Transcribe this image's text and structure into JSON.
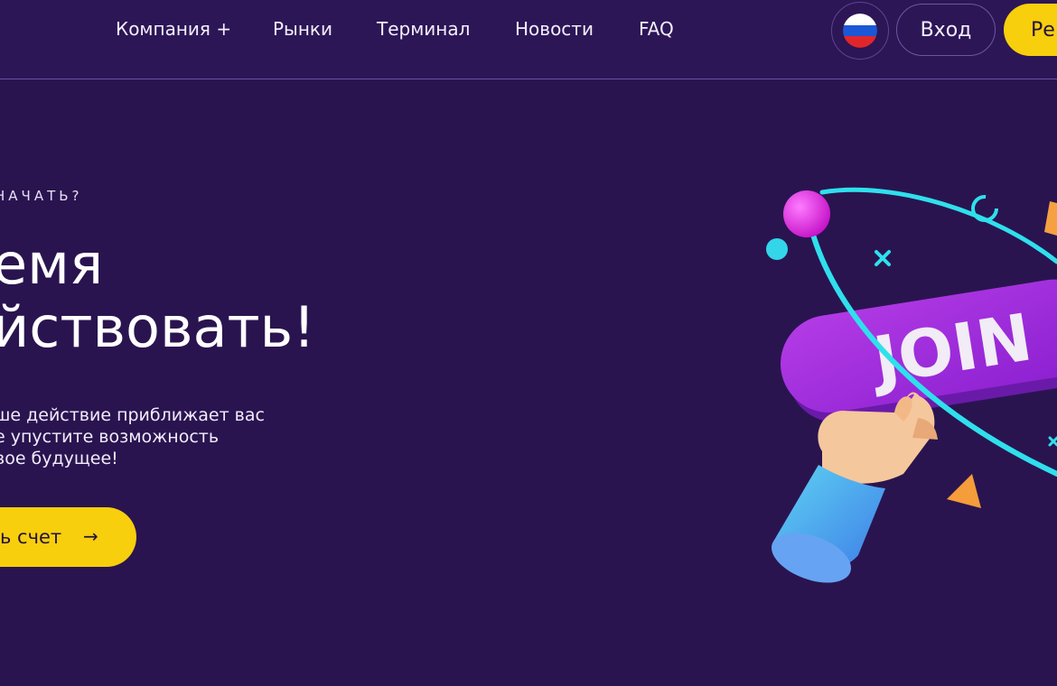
{
  "header": {
    "nav": [
      {
        "label": "Компания +"
      },
      {
        "label": "Рынки"
      },
      {
        "label": "Терминал"
      },
      {
        "label": "Новости"
      },
      {
        "label": "FAQ"
      }
    ],
    "language_icon": "russia-flag-icon",
    "login_label": "Вход",
    "register_label": "Ре"
  },
  "hero": {
    "eyebrow": "НАЧАТЬ?",
    "headline_line1": "емя",
    "headline_line2": "йствовать!",
    "description_line1": "ше действие приближает вас",
    "description_line2": "е упустите возможность",
    "description_line3": "вое будущее!",
    "cta_label": "ь счет",
    "cta_icon": "→",
    "illustration_text": "JOIN"
  },
  "colors": {
    "background": "#2a1450",
    "header_bg": "#2c1656",
    "accent_yellow": "#f7cf0c",
    "purple_button": "#9c27d8",
    "cyan": "#2fe0ec"
  }
}
